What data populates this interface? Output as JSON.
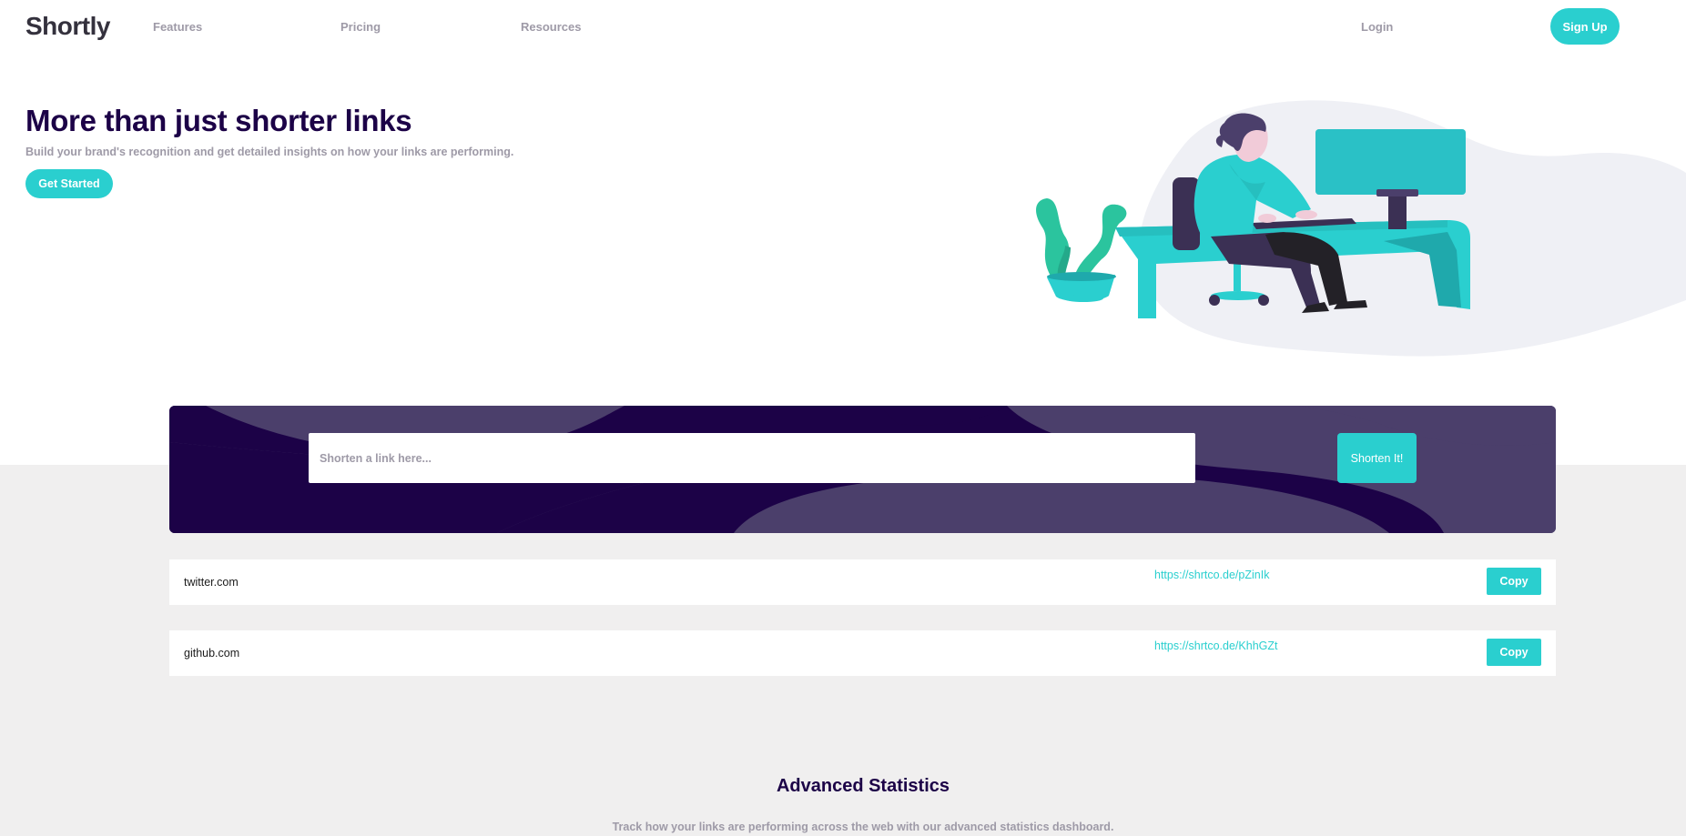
{
  "nav": {
    "logo": "Shortly",
    "links": [
      "Features",
      "Pricing",
      "Resources"
    ],
    "login": "Login",
    "signup": "Sign Up"
  },
  "hero": {
    "title": "More than just shorter links",
    "subtitle": "Build your brand's recognition and get detailed insights on how your links are performing.",
    "cta": "Get Started",
    "illustration_icon": "person-working-illustration"
  },
  "shorten": {
    "placeholder": "Shorten a link here...",
    "button": "Shorten It!"
  },
  "results": [
    {
      "original": "twitter.com",
      "short": "https://shrtco.de/pZinIk",
      "copy": "Copy"
    },
    {
      "original": "github.com",
      "short": "https://shrtco.de/KhhGZt",
      "copy": "Copy"
    }
  ],
  "stats": {
    "title": "Advanced Statistics",
    "subtitle": "Track how your links are performing across the web with our advanced statistics dashboard."
  },
  "colors": {
    "accent": "#2acfcf",
    "dark_violet": "#3b3054",
    "very_dark_violet": "#1c0247",
    "gray": "#9e9aa7",
    "background_gray": "#f0efef"
  }
}
